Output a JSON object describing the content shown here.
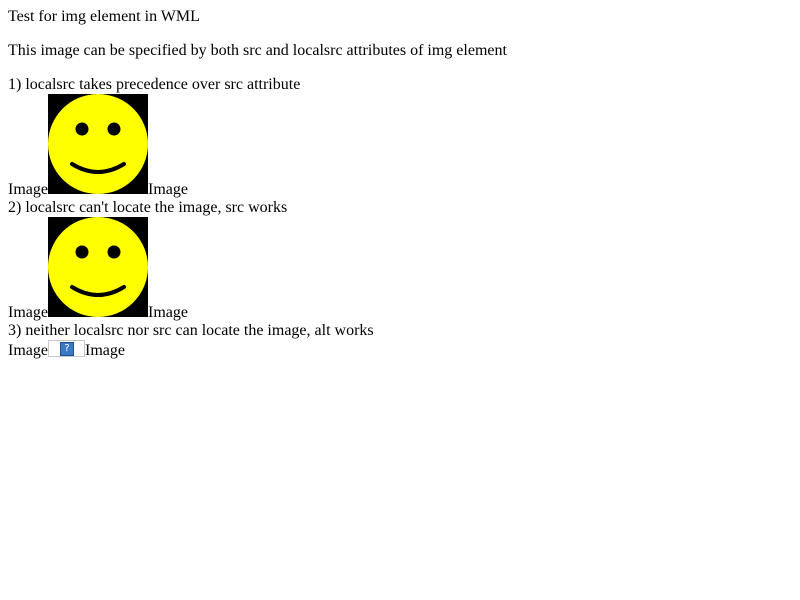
{
  "document": {
    "title": "Test for img element in WML",
    "intro": "This image can be specified by both src and localsrc attributes of img element"
  },
  "cases": [
    {
      "title": "1) localsrc takes precedence over src attribute",
      "label_before": "Image",
      "label_after": "Image",
      "image": "smiley-face"
    },
    {
      "title": "2) localsrc can't locate the image, src works",
      "label_before": "Image",
      "label_after": "Image",
      "image": "smiley-face"
    },
    {
      "title": "3) neither localsrc nor src can locate the image, alt works",
      "label_before": "Image",
      "label_after": "Image",
      "image": "broken-image-icon",
      "broken_glyph": "?"
    }
  ],
  "colors": {
    "smiley_fill": "#ffff00",
    "smiley_background": "#000000",
    "smiley_features": "#000000",
    "broken_icon": "#3b79c6"
  }
}
